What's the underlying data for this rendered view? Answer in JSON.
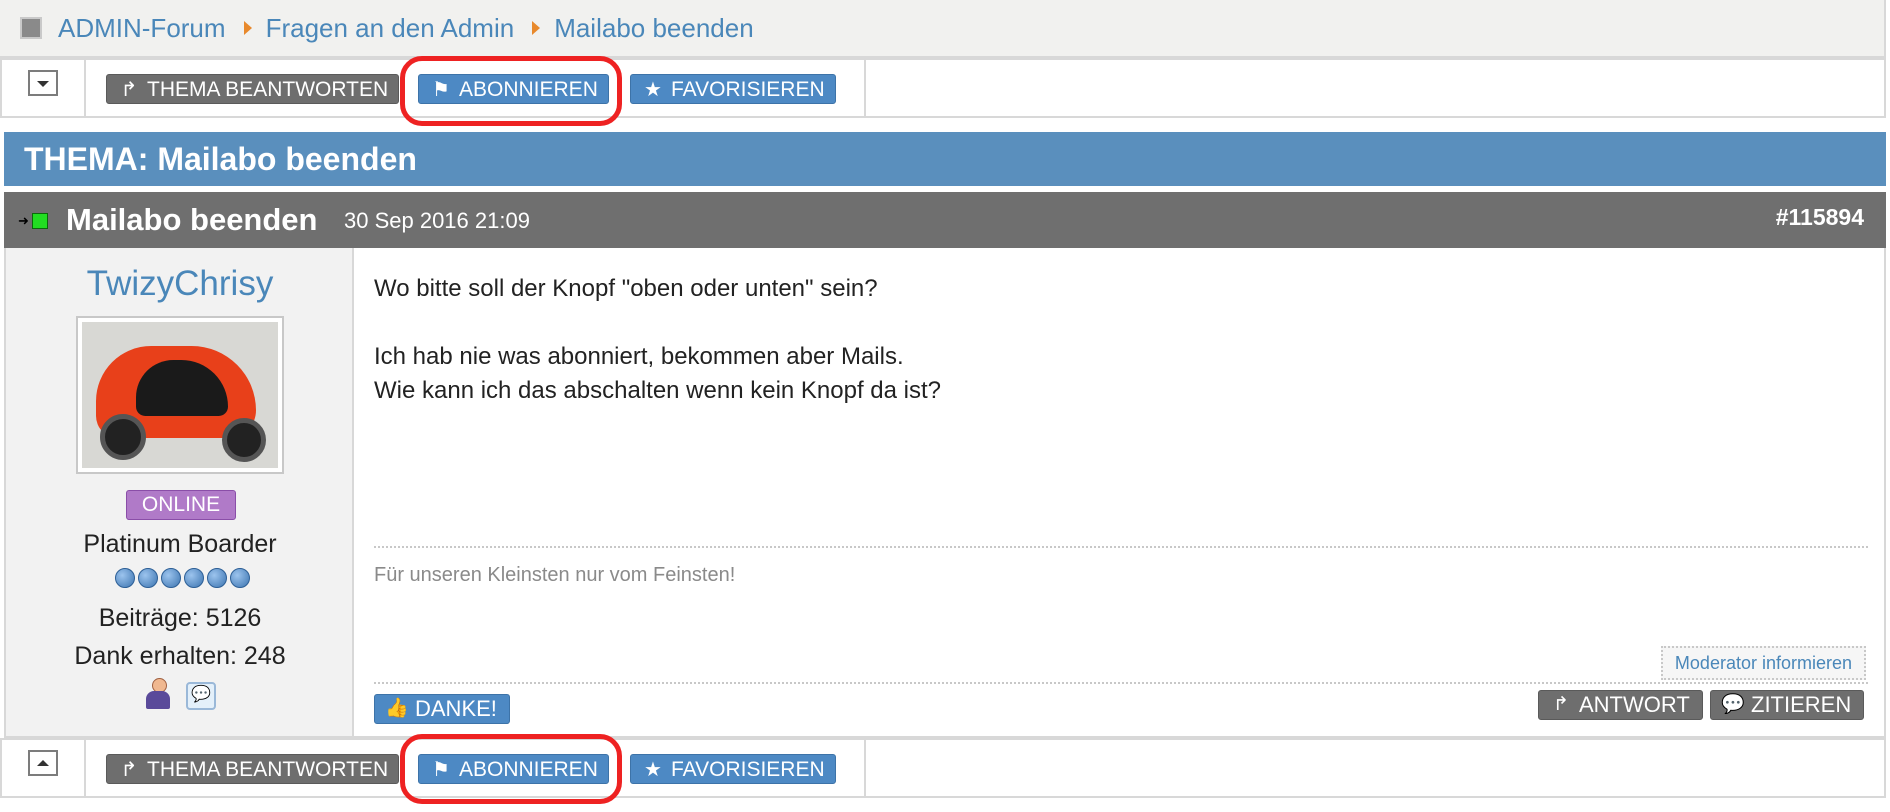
{
  "breadcrumb": {
    "items": [
      "ADMIN-Forum",
      "Fragen an den Admin",
      "Mailabo beenden"
    ]
  },
  "toolbar": {
    "reply_label": "THEMA BEANTWORTEN",
    "subscribe_label": "ABONNIEREN",
    "favorite_label": "FAVORISIEREN"
  },
  "topic": {
    "header": "THEMA: Mailabo beenden"
  },
  "post": {
    "title": "Mailabo beenden",
    "date": "30 Sep 2016 21:09",
    "id": "#115894",
    "message_lines": [
      "Wo bitte soll der Knopf \"oben oder unten\" sein?",
      "Ich hab nie was abonniert, bekommen aber Mails.",
      "Wie kann ich das abschalten wenn kein Knopf da ist?"
    ],
    "signature": "Für unseren Kleinsten nur vom Feinsten!",
    "moderator_label": "Moderator informieren",
    "thanks_label": "DANKE!",
    "answer_label": "ANTWORT",
    "quote_label": "ZITIEREN"
  },
  "author": {
    "username": "TwizyChrisy",
    "status": "ONLINE",
    "rank": "Platinum Boarder",
    "rank_level": 6,
    "posts": "Beiträge: 5126",
    "thanks": "Dank erhalten: 248"
  },
  "colors": {
    "highlight": "#ee2222",
    "topic_header": "#5a8fbd",
    "post_header": "#6f6f6f",
    "link": "#4a87b9",
    "online_badge": "#b07ac8"
  }
}
